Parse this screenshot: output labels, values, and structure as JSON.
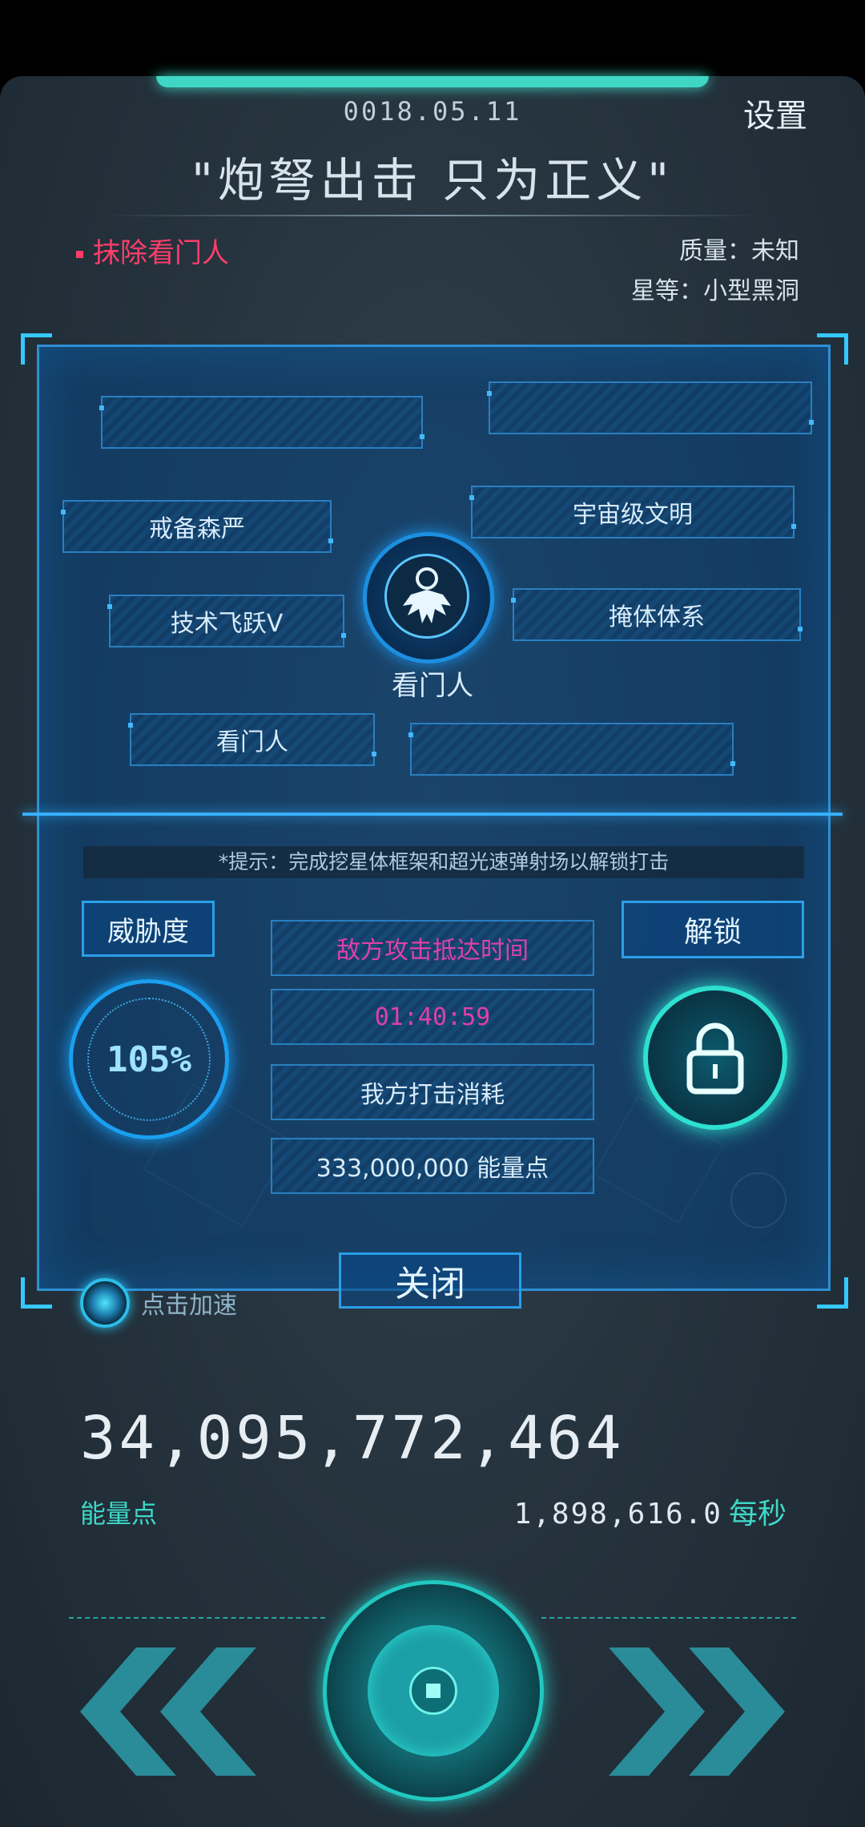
{
  "header": {
    "date": "0018.05.11",
    "settings_label": "设置",
    "motto": "\"炮弩出击 只为正义\""
  },
  "mission": {
    "target_label": "抹除看门人",
    "quality": "质量：未知",
    "star_class": "星等：小型黑洞"
  },
  "panel": {
    "traits": [
      "",
      "",
      "戒备森严",
      "宇宙级文明",
      "技术飞跃V",
      "掩体体系",
      "看门人",
      ""
    ],
    "emblem_label": "看门人",
    "hint": "*提示：完成挖星体框架和超光速弹射场以解锁打击",
    "threat_label": "威胁度",
    "threat_value": "105%",
    "unlock_label": "解锁",
    "enemy_arrival_label": "敌方攻击抵达时间",
    "enemy_arrival_time": "01:40:59",
    "our_cost_label": "我方打击消耗",
    "our_cost_value": "333,000,000 能量点",
    "close_label": "关闭"
  },
  "boost_label": "点击加速",
  "energy": {
    "total": "34,095,772,464",
    "unit": "能量点",
    "rate": "1,898,616.0",
    "rate_unit": "每秒"
  },
  "icons": [
    "watchman-emblem-icon",
    "lock-icon",
    "boost-icon",
    "rewind-icon",
    "fast-forward-icon",
    "globe-icon"
  ],
  "colors": {
    "accent": "#2a9fea",
    "teal": "#2ee0d0",
    "mission_red": "#ff3d6a",
    "enemy_text": "#e040a8"
  }
}
